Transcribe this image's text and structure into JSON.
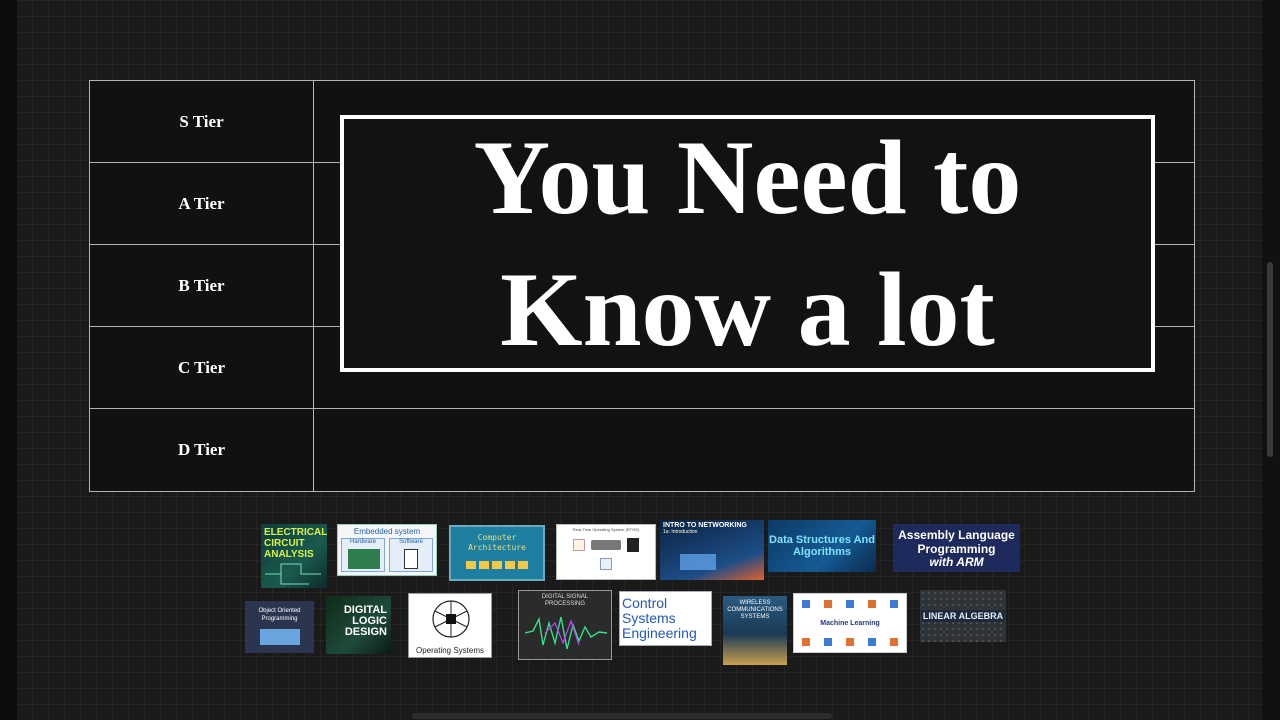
{
  "tiers": [
    {
      "label": "S Tier"
    },
    {
      "label": "A Tier"
    },
    {
      "label": "B Tier"
    },
    {
      "label": "C Tier"
    },
    {
      "label": "D Tier"
    }
  ],
  "overlay": {
    "line1": "You Need to",
    "line2": "Know a lot"
  },
  "cards": {
    "electrical": "ELECTRICAL CIRCUIT ANALYSIS",
    "embedded_title": "Embedded system",
    "embedded_hw": "Hardware",
    "embedded_sw": "Software",
    "comp_arch": "Computer Architecture",
    "rtos": "Real-Time Operating System (RTOS)",
    "networking": "INTRO TO NETWORKING",
    "networking_sub": "1a: Introduction",
    "dsa": "Data Structures And Algorithms",
    "assembly_line1": "Assembly Language Programming",
    "assembly_line2": "with ARM",
    "oop": "Object Oriented Programming",
    "digital_logic": "DIGITAL LOGIC DESIGN",
    "os": "Operating Systems",
    "dsp": "DIGITAL SIGNAL PROCESSING",
    "control": "Control Systems Engineering",
    "wireless": "WIRELESS COMMUNICATIONS SYSTEMS",
    "ml": "Machine Learning",
    "linear_algebra": "LINEAR ALGEBRA"
  },
  "colors": {
    "background": "#1a1a1a",
    "table_bg": "#111111",
    "border": "#b5b5b5",
    "text": "#ffffff"
  }
}
